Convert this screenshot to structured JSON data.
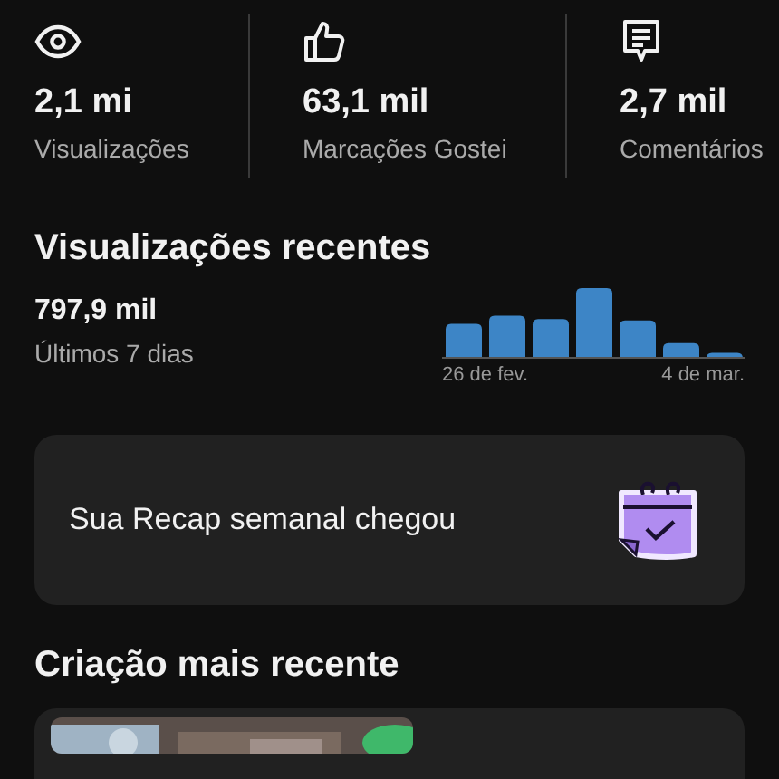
{
  "stats": [
    {
      "value": "2,1 mi",
      "label": "Visualizações"
    },
    {
      "value": "63,1 mil",
      "label": "Marcações Gostei"
    },
    {
      "value": "2,7 mil",
      "label": "Comentários"
    }
  ],
  "recent_views": {
    "title": "Visualizações recentes",
    "value": "797,9 mil",
    "period": "Últimos 7 dias",
    "start_label": "26 de fev.",
    "end_label": "4 de mar."
  },
  "recap_card": {
    "text": "Sua Recap semanal chegou"
  },
  "latest_creation": {
    "title": "Criação mais recente"
  }
}
